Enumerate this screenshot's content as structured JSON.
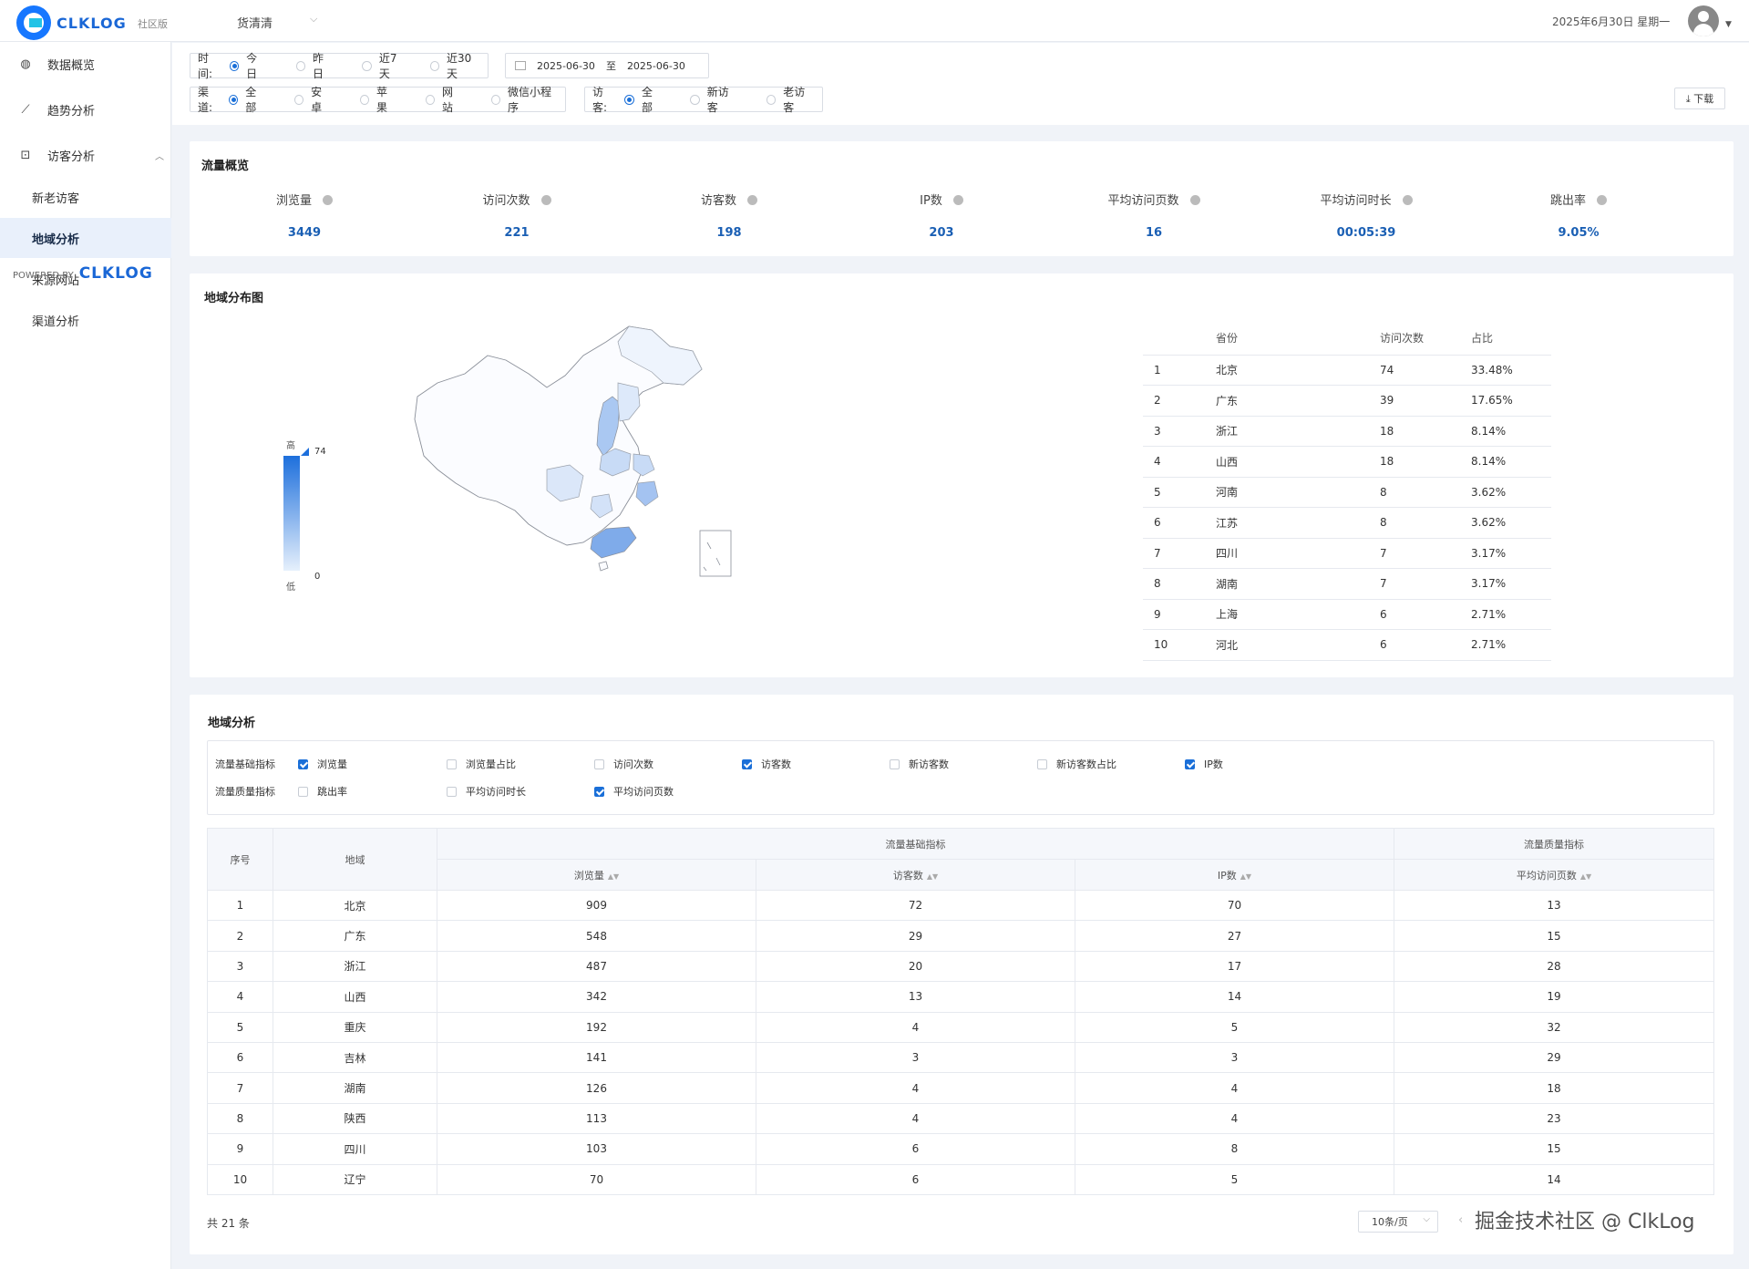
{
  "header": {
    "logo_text": "CLKLOG",
    "edition": "社区版",
    "project": "货清清",
    "date": "2025年6月30日 星期一"
  },
  "sidebar": {
    "items": [
      {
        "label": "数据概览",
        "icon": "dashboard-icon"
      },
      {
        "label": "趋势分析",
        "icon": "line-chart-icon"
      },
      {
        "label": "访客分析",
        "icon": "visitor-icon"
      },
      {
        "label": "新老访客"
      },
      {
        "label": "地域分析"
      },
      {
        "label": "来源网站"
      },
      {
        "label": "渠道分析"
      }
    ],
    "powered_prefix": "POWERED BY",
    "powered_logo": "CLKLOG"
  },
  "filters": {
    "time_label": "时间:",
    "time_options": [
      "今日",
      "昨日",
      "近7天",
      "近30天"
    ],
    "date_start": "2025-06-30",
    "date_sep": "至",
    "date_end": "2025-06-30",
    "channel_label": "渠道:",
    "channel_options": [
      "全部",
      "安卓",
      "苹果",
      "网站",
      "微信小程序"
    ],
    "visitor_label": "访客:",
    "visitor_options": [
      "全部",
      "新访客",
      "老访客"
    ],
    "download_label": "⤓ 下载"
  },
  "overview": {
    "title": "流量概览",
    "metrics": [
      {
        "label": "浏览量",
        "value": "3449"
      },
      {
        "label": "访问次数",
        "value": "221"
      },
      {
        "label": "访客数",
        "value": "198"
      },
      {
        "label": "IP数",
        "value": "203"
      },
      {
        "label": "平均访问页数",
        "value": "16"
      },
      {
        "label": "平均访问时长",
        "value": "00:05:39"
      },
      {
        "label": "跳出率",
        "value": "9.05%"
      }
    ]
  },
  "map_card": {
    "title": "地域分布图",
    "legend": {
      "high": "高",
      "low": "低",
      "max": "74",
      "min": "0"
    },
    "table_headers": [
      "",
      "省份",
      "访问次数",
      "占比"
    ],
    "rows": [
      [
        "1",
        "北京",
        "74",
        "33.48%"
      ],
      [
        "2",
        "广东",
        "39",
        "17.65%"
      ],
      [
        "3",
        "浙江",
        "18",
        "8.14%"
      ],
      [
        "4",
        "山西",
        "18",
        "8.14%"
      ],
      [
        "5",
        "河南",
        "8",
        "3.62%"
      ],
      [
        "6",
        "江苏",
        "8",
        "3.62%"
      ],
      [
        "7",
        "四川",
        "7",
        "3.17%"
      ],
      [
        "8",
        "湖南",
        "7",
        "3.17%"
      ],
      [
        "9",
        "上海",
        "6",
        "2.71%"
      ],
      [
        "10",
        "河北",
        "6",
        "2.71%"
      ]
    ]
  },
  "analysis": {
    "title": "地域分析",
    "basic_label": "流量基础指标",
    "quality_label": "流量质量指标",
    "basic_checks": [
      {
        "label": "浏览量",
        "checked": true
      },
      {
        "label": "浏览量占比",
        "checked": false
      },
      {
        "label": "访问次数",
        "checked": false
      },
      {
        "label": "访客数",
        "checked": true
      },
      {
        "label": "新访客数",
        "checked": false
      },
      {
        "label": "新访客数占比",
        "checked": false
      },
      {
        "label": "IP数",
        "checked": true
      }
    ],
    "quality_checks": [
      {
        "label": "跳出率",
        "checked": false
      },
      {
        "label": "平均访问时长",
        "checked": false
      },
      {
        "label": "平均访问页数",
        "checked": true
      }
    ],
    "table": {
      "col_index": "序号",
      "col_region": "地域",
      "group_basic": "流量基础指标",
      "group_quality": "流量质量指标",
      "cols": [
        "浏览量",
        "访客数",
        "IP数",
        "平均访问页数"
      ],
      "rows": [
        [
          "1",
          "北京",
          "909",
          "72",
          "70",
          "13"
        ],
        [
          "2",
          "广东",
          "548",
          "29",
          "27",
          "15"
        ],
        [
          "3",
          "浙江",
          "487",
          "20",
          "17",
          "28"
        ],
        [
          "4",
          "山西",
          "342",
          "13",
          "14",
          "19"
        ],
        [
          "5",
          "重庆",
          "192",
          "4",
          "5",
          "32"
        ],
        [
          "6",
          "吉林",
          "141",
          "3",
          "3",
          "29"
        ],
        [
          "7",
          "湖南",
          "126",
          "4",
          "4",
          "18"
        ],
        [
          "8",
          "陕西",
          "113",
          "4",
          "4",
          "23"
        ],
        [
          "9",
          "四川",
          "103",
          "6",
          "8",
          "15"
        ],
        [
          "10",
          "辽宁",
          "70",
          "6",
          "5",
          "14"
        ]
      ]
    },
    "total": "共 21 条",
    "page_size": "10条/页",
    "watermark": "掘金技术社区 @ ClkLog"
  }
}
